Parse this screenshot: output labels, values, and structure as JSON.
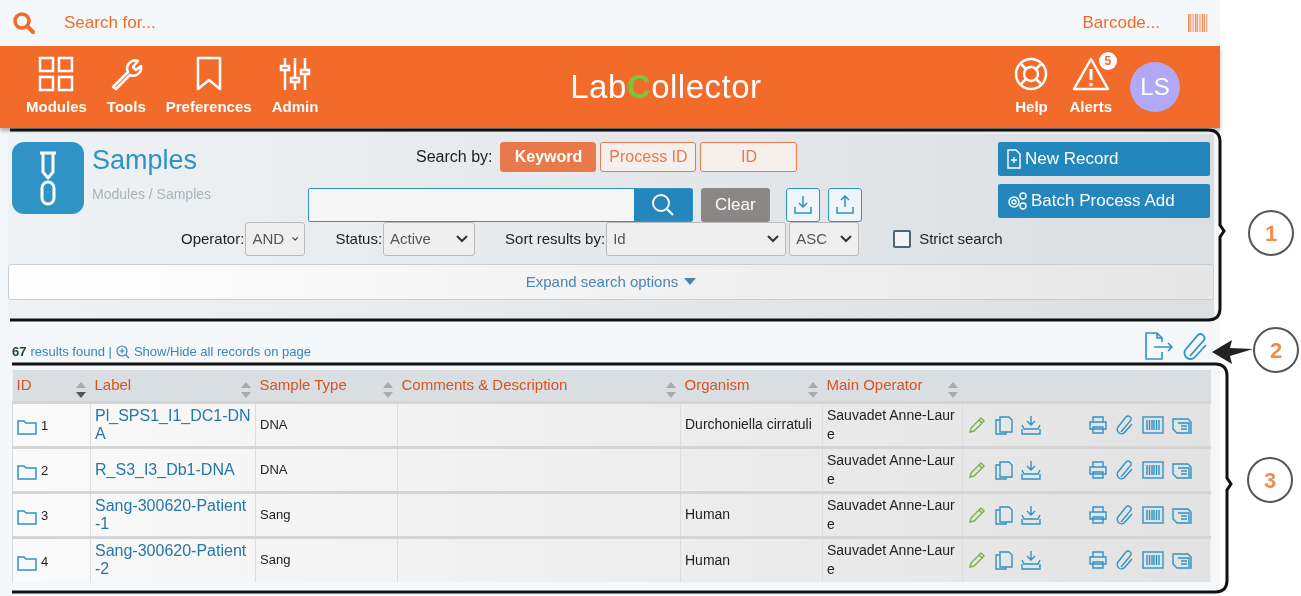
{
  "top_search": {
    "placeholder": "Search for...",
    "barcode_placeholder": "Barcode..."
  },
  "nav": [
    {
      "label": "Modules",
      "kind": "grid"
    },
    {
      "label": "Tools",
      "kind": "wrench"
    },
    {
      "label": "Preferences",
      "kind": "bookmark"
    },
    {
      "label": "Admin",
      "kind": "sliders"
    }
  ],
  "logo": [
    {
      "text": "Lab",
      "accent": false
    },
    {
      "text": "C",
      "accent": true
    },
    {
      "text": "ollector",
      "accent": false
    }
  ],
  "nav_right": [
    {
      "label": "Help",
      "kind": "help"
    },
    {
      "label": "Alerts",
      "kind": "alert",
      "badge": "5"
    }
  ],
  "avatar": "LS",
  "module": {
    "title": "Samples",
    "breadcrumb": "Modules / Samples"
  },
  "search_by": {
    "label": "Search by:",
    "options": [
      {
        "label": "Keyword",
        "selected": true
      },
      {
        "label": "Process ID",
        "selected": false
      },
      {
        "label": "ID",
        "selected": false
      }
    ]
  },
  "clear_button": "Clear",
  "actions": [
    {
      "label": "New Record",
      "kind": "new"
    },
    {
      "label": "Batch Process Add",
      "kind": "batch"
    }
  ],
  "filters": [
    {
      "label": "Operator:",
      "value": "AND",
      "kind": "select"
    },
    {
      "label": "Status:",
      "value": "Active",
      "kind": "select"
    },
    {
      "label": "Sort results by:",
      "value": "Id",
      "kind": "select"
    },
    {
      "value": "ASC",
      "kind": "select"
    },
    {
      "label": "Strict search",
      "checked": false,
      "kind": "checkbox"
    }
  ],
  "expand_link": "Expand search options",
  "results": {
    "count": "67",
    "text": "results found |",
    "toggle": "Show/Hide all records on page"
  },
  "table": {
    "columns": [
      {
        "label": "ID",
        "sorted": true
      },
      {
        "label": "Label",
        "sorted": false
      },
      {
        "label": "Sample Type",
        "sorted": false
      },
      {
        "label": "Comments & Description",
        "sorted": false
      },
      {
        "label": "Organism",
        "sorted": false
      },
      {
        "label": "Main Operator",
        "sorted": false
      }
    ],
    "rows": [
      {
        "id": "1",
        "label": "Pl_SPS1_I1_DC1-DNA",
        "sample_type": "DNA",
        "organism": "Durchoniella cirratuli",
        "operator": "Sauvadet Anne-Laure"
      },
      {
        "id": "2",
        "label": "R_S3_I3_Db1-DNA",
        "sample_type": "DNA",
        "operator": "Sauvadet Anne-Laure"
      },
      {
        "id": "3",
        "label": "Sang-300620-Patient-1",
        "sample_type": "Sang",
        "organism": "Human",
        "operator": "Sauvadet Anne-Laure"
      },
      {
        "id": "4",
        "label": "Sang-300620-Patient-2",
        "sample_type": "Sang",
        "organism": "Human",
        "operator": "Sauvadet Anne-Laure"
      }
    ]
  },
  "callouts": [
    "1",
    "2",
    "3"
  ]
}
